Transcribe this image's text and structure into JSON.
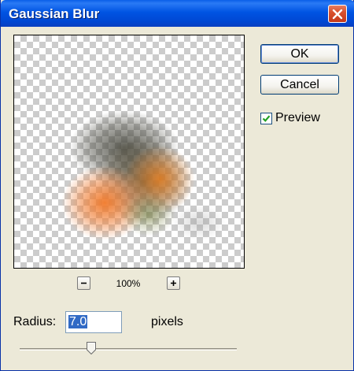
{
  "window": {
    "title": "Gaussian Blur"
  },
  "buttons": {
    "ok": "OK",
    "cancel": "Cancel"
  },
  "preview_option": {
    "label": "Preview",
    "checked": true
  },
  "zoom": {
    "level": "100%"
  },
  "radius": {
    "label": "Radius:",
    "value": "7.0",
    "unit": "pixels"
  },
  "slider": {
    "fraction": 0.33
  },
  "icons": {
    "close": "close-icon",
    "zoom_out": "minus-icon",
    "zoom_in": "plus-icon",
    "check": "checkmark-icon"
  },
  "colors": {
    "title_bar": "#0054e3",
    "close_button": "#d9512e",
    "selection": "#316ac5",
    "dialog_bg": "#ece9d8"
  }
}
